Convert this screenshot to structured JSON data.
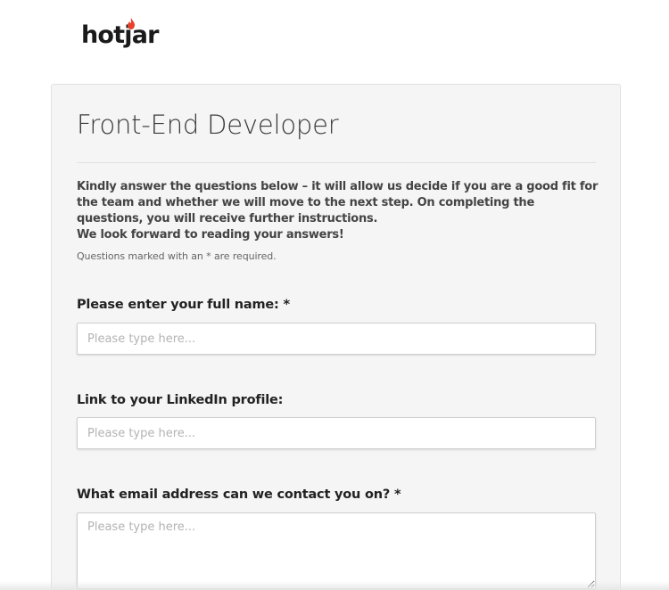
{
  "brand": {
    "logo_prefix": "hot",
    "logo_j": "j",
    "logo_suffix": "ar",
    "accent_color": "#e8412c"
  },
  "form": {
    "title": "Front-End Developer",
    "intro": "Kindly answer the questions below – it will allow us decide if you are a good fit for the team and whether we will move to the next step. On completing the questions, you will receive further instructions.",
    "intro_line2": "We look forward to reading your answers!",
    "required_note": "Questions marked with an * are required.",
    "questions": [
      {
        "label": "Please enter your full name: *",
        "placeholder": "Please type here...",
        "value": ""
      },
      {
        "label": "Link to your LinkedIn profile:",
        "placeholder": "Please type here...",
        "value": ""
      },
      {
        "label": "What email address can we contact you on? *",
        "placeholder": "Please type here...",
        "value": ""
      }
    ]
  }
}
